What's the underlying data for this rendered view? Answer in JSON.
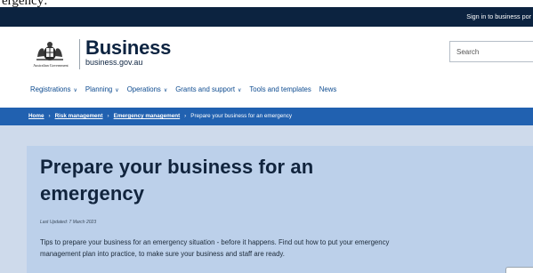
{
  "top_caption": "ergency:",
  "utility": {
    "signin_label": "Sign in to business por"
  },
  "header": {
    "gov_label": "Australian Government",
    "brand_name": "Business",
    "brand_url": "business.gov.au",
    "search_placeholder": "Search"
  },
  "nav": {
    "items": [
      {
        "label": "Registrations",
        "has_menu": true
      },
      {
        "label": "Planning",
        "has_menu": true
      },
      {
        "label": "Operations",
        "has_menu": true
      },
      {
        "label": "Grants and support",
        "has_menu": true
      },
      {
        "label": "Tools and templates",
        "has_menu": false
      },
      {
        "label": "News",
        "has_menu": false
      }
    ],
    "chevron": "∨"
  },
  "breadcrumb": {
    "items": [
      "Home",
      "Risk management",
      "Emergency management"
    ],
    "current": "Prepare your business for an emergency",
    "separator": "›"
  },
  "page": {
    "title": "Prepare your business for an emergency",
    "last_updated": "Last Updated: 7 March 2023",
    "description": "Tips to prepare your business for an emergency situation - before it happens. Find out how to put your emergency management plan into practice, to make sure your business and staff are ready."
  },
  "colors": {
    "utility_bar": "#0c2340",
    "breadcrumb_bar": "#2161b0",
    "hero_bg": "#cedaeb",
    "card_bg": "#bcd0ea",
    "nav_link": "#0c4a8f"
  }
}
